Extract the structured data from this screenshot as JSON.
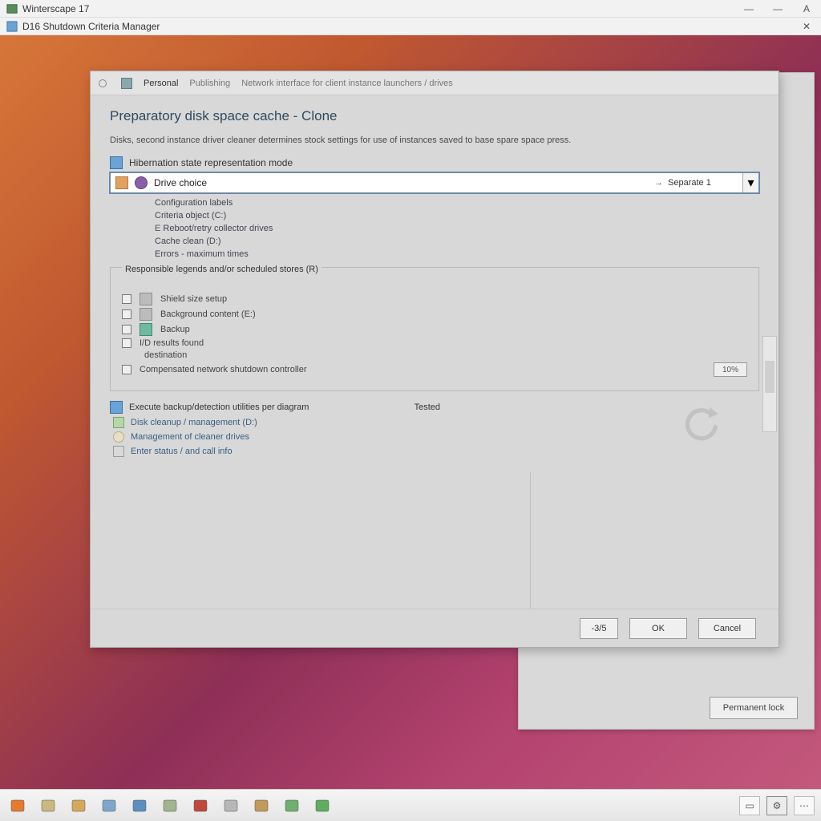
{
  "titlebar1": {
    "title": "Winterscape 17",
    "min": "—",
    "max": "—",
    "close": "A"
  },
  "titlebar2": {
    "title": "D16 Shutdown Criteria Manager",
    "close": "✕"
  },
  "parent_window": {
    "apply_label": "Permanent lock"
  },
  "dialog": {
    "header": {
      "tab_primary": "Personal",
      "tab_secondary": "Publishing",
      "tab_tertiary": "Network interface for client instance launchers / drives"
    },
    "title": "Preparatory disk space cache - Clone",
    "description": "Disks, second instance driver cleaner determines stock settings for use of instances saved to base spare space press.",
    "row_category": "Hibernation state representation mode",
    "combo": {
      "icon_name": "disk-icon",
      "label": "Drive choice",
      "value": "Separate 1",
      "arrow": "→"
    },
    "indent": [
      "Configuration labels",
      "Criteria object (C:)",
      "Reboot/retry collector drives",
      "Cache clean (D:)",
      "Errors  - maximum times"
    ],
    "groupbox": {
      "legend": "Responsible legends and/or scheduled stores (R)",
      "rows": [
        {
          "label": "Shield size setup"
        },
        {
          "label": "Background content (E:)"
        },
        {
          "label": "Backup"
        },
        {
          "label": "I/D results found"
        },
        {
          "label": "destination"
        },
        {
          "label": "Compensated network shutdown controller",
          "pct": "10%"
        }
      ]
    },
    "see_also": {
      "header": "Execute backup/detection utilities per diagram",
      "value_label": "Tested",
      "links": [
        "Disk cleanup / management (D:)",
        "Management of cleaner drives",
        "Enter status / and call info"
      ]
    },
    "buttons": {
      "back": "-3/5",
      "ok": "OK",
      "cancel": "Cancel"
    }
  },
  "taskbar": {
    "icons": [
      {
        "name": "start-icon",
        "color": "#e67a2e"
      },
      {
        "name": "search-icon",
        "color": "#c9b97f"
      },
      {
        "name": "mail-icon",
        "color": "#d6a85c"
      },
      {
        "name": "monitor-icon",
        "color": "#7fa7c9"
      },
      {
        "name": "folder-icon",
        "color": "#5c8fbf"
      },
      {
        "name": "notes-icon",
        "color": "#9fb48f"
      },
      {
        "name": "bug-icon",
        "color": "#c0483a"
      },
      {
        "name": "drive-icon",
        "color": "#b7b7b7"
      },
      {
        "name": "shield-icon",
        "color": "#c29a5a"
      },
      {
        "name": "table-icon",
        "color": "#6fae6f"
      },
      {
        "name": "sheet-icon",
        "color": "#5fae5f"
      }
    ],
    "tray": [
      {
        "name": "tray-app-icon",
        "glyph": "▭"
      },
      {
        "name": "tray-gear-icon",
        "glyph": "⚙"
      },
      {
        "name": "tray-more-icon",
        "glyph": "⋯"
      }
    ]
  }
}
